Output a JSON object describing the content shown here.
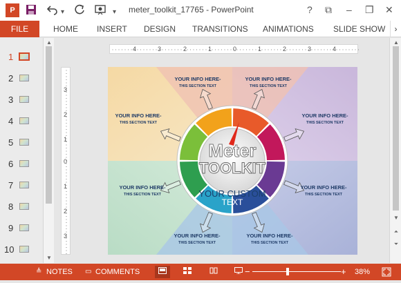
{
  "window": {
    "title": "meter_toolkit_17765 - PowerPoint",
    "help": "?",
    "ribbon_display": "⧉",
    "minimize": "–",
    "restore": "❐",
    "close": "✕"
  },
  "quick_access": {
    "app_icon": "powerpoint-icon",
    "save": "save-icon",
    "undo": "undo-icon",
    "undo_dropdown": "▾",
    "redo": "redo-icon",
    "start_from_beginning": "slideshow-icon",
    "customize": "▾"
  },
  "ribbon": {
    "file": "FILE",
    "tabs": [
      "HOME",
      "INSERT",
      "DESIGN",
      "TRANSITIONS",
      "ANIMATIONS",
      "SLIDE SHOW"
    ],
    "scroll": "›"
  },
  "thumbnails": {
    "slides": [
      "1",
      "2",
      "3",
      "4",
      "5",
      "6",
      "7",
      "8",
      "9",
      "10"
    ],
    "selected_index": 0
  },
  "rulers": {
    "horizontal": [
      "4",
      "3",
      "2",
      "1",
      "0",
      "1",
      "2",
      "3",
      "4"
    ],
    "vertical": [
      "3",
      "2",
      "1",
      "0",
      "1",
      "2",
      "3"
    ]
  },
  "slide": {
    "background_quadrants": {
      "top_left": "#f5d9a4",
      "top_right": "#c9b7db",
      "bottom_left": "#b9dcc5",
      "bottom_right": "#a9b2d8",
      "top": "#f0c2b3",
      "bottom": "#a9c7e6"
    },
    "sections": [
      {
        "title": "YOUR INFO HERE-",
        "sub": "THIS SECTION TEXT"
      },
      {
        "title": "YOUR INFO HERE-",
        "sub": "THIS SECTION TEXT"
      },
      {
        "title": "YOUR INFO HERE-",
        "sub": "THIS SECTION TEXT"
      },
      {
        "title": "YOUR INFO HERE-",
        "sub": "THIS SECTION TEXT"
      },
      {
        "title": "YOUR INFO HERE-",
        "sub": "THIS SECTION TEXT"
      },
      {
        "title": "YOUR INFO HERE-",
        "sub": "THIS SECTION TEXT"
      },
      {
        "title": "YOUR INFO HERE-",
        "sub": "THIS SECTION TEXT"
      },
      {
        "title": "YOUR INFO HERE-",
        "sub": "THIS SECTION TEXT"
      }
    ],
    "meter": {
      "line1": "Meter",
      "line2": "TOOLKIT",
      "custom_line1": "YOUR CUSTOM",
      "custom_line2": "TEXT",
      "segment_colors": [
        "#e85a2a",
        "#c2185b",
        "#6a3a93",
        "#2a4f9a",
        "#2aa3c9",
        "#2e9e4f",
        "#7bbf3a",
        "#f2a21b"
      ]
    }
  },
  "statusbar": {
    "notes": "NOTES",
    "comments": "COMMENTS",
    "zoom_out": "−",
    "zoom_in": "+",
    "zoom": "38%",
    "zoom_fraction": 0.38
  }
}
